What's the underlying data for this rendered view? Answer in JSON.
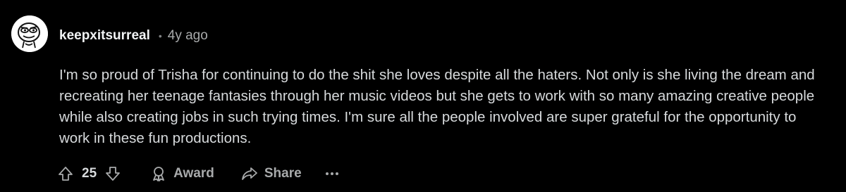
{
  "comment": {
    "author": "keepxitsurreal",
    "separator": "•",
    "timestamp": "4y ago",
    "body": "I'm so proud of Trisha for continuing to do the shit she loves despite all the haters. Not only is she living the dream and recreating her teenage fantasies through her music videos but she gets to work with so many amazing creative people while also creating jobs in such trying times. I'm sure all the people involved are super grateful for the opportunity to work in these fun productions.",
    "avatar_icon": "snoo-avatar-icon"
  },
  "actions": {
    "upvote_icon": "upvote-arrow-icon",
    "vote_count": "25",
    "downvote_icon": "downvote-arrow-icon",
    "award_label": "Award",
    "award_icon": "award-ribbon-icon",
    "share_label": "Share",
    "share_icon": "share-arrow-icon",
    "more_icon": "ellipsis-icon"
  },
  "colors": {
    "background": "#000000",
    "text": "#D7DADC",
    "muted": "#A8AAAB"
  }
}
